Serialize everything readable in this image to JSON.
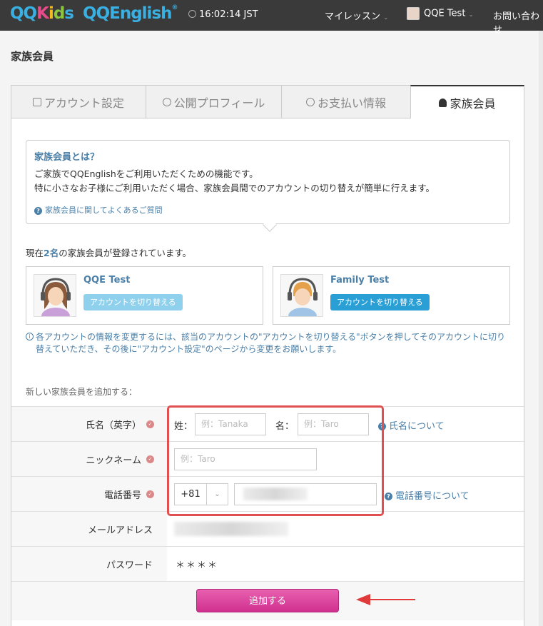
{
  "header": {
    "logo": {
      "qq1": "QQ",
      "kids": [
        "K",
        "i",
        "d",
        "s"
      ],
      "qq2": "QQ",
      "english": "English",
      "reg": "®"
    },
    "clock": "16:02:14 JST",
    "nav": {
      "my_lesson": "マイレッスン",
      "user": "QQE Test",
      "contact": "お問い合わせ"
    }
  },
  "page_title": "家族会員",
  "tabs": [
    {
      "label": "アカウント設定",
      "icon": "id-card-icon"
    },
    {
      "label": "公開プロフィール",
      "icon": "globe-icon"
    },
    {
      "label": "お支払い情報",
      "icon": "dollar-icon"
    },
    {
      "label": "家族会員",
      "icon": "user-icon",
      "active": true
    }
  ],
  "info": {
    "title": "家族会員とは？",
    "line1": "ご家族でQQEnglishをご利用いただくための機能です。",
    "line2": "特に小さなお子様にご利用いただく場合、家族会員間でのアカウントの切り替えが簡単に行えます。",
    "faq": "家族会員に関してよくあるご質問"
  },
  "registered": {
    "prefix": "現在",
    "count": "2名",
    "suffix": "の家族会員が登録されています。"
  },
  "members": [
    {
      "name": "QQE Test",
      "button": "アカウントを切り替える",
      "enabled": false
    },
    {
      "name": "Family Test",
      "button": "アカウントを切り替える",
      "enabled": true
    }
  ],
  "note": "各アカウントの情報を変更するには、該当のアカウントの\"アカウントを切り替える\"ボタンを押してそのアカウントに切り替えていただき、その後に\"アカウント設定\"のページから変更をお願いします。",
  "add_label": "新しい家族会員を追加する：",
  "form": {
    "name_label": "氏名（英字）",
    "last_name_label": "姓：",
    "last_name_placeholder": "例：Tanaka",
    "first_name_label": "名：",
    "first_name_placeholder": "例：Taro",
    "name_help": "氏名について",
    "nickname_label": "ニックネーム",
    "nickname_placeholder": "例：Taro",
    "phone_label": "電話番号",
    "country_code": "+81",
    "phone_help": "電話番号について",
    "email_label": "メールアドレス",
    "password_label": "パスワード",
    "password_value": "＊＊＊＊"
  },
  "submit_label": "追加する",
  "colors": {
    "accent": "#4a7fa8",
    "submit": "#d0308e",
    "highlight": "#e05050",
    "header_bg": "#3a3a3a"
  }
}
